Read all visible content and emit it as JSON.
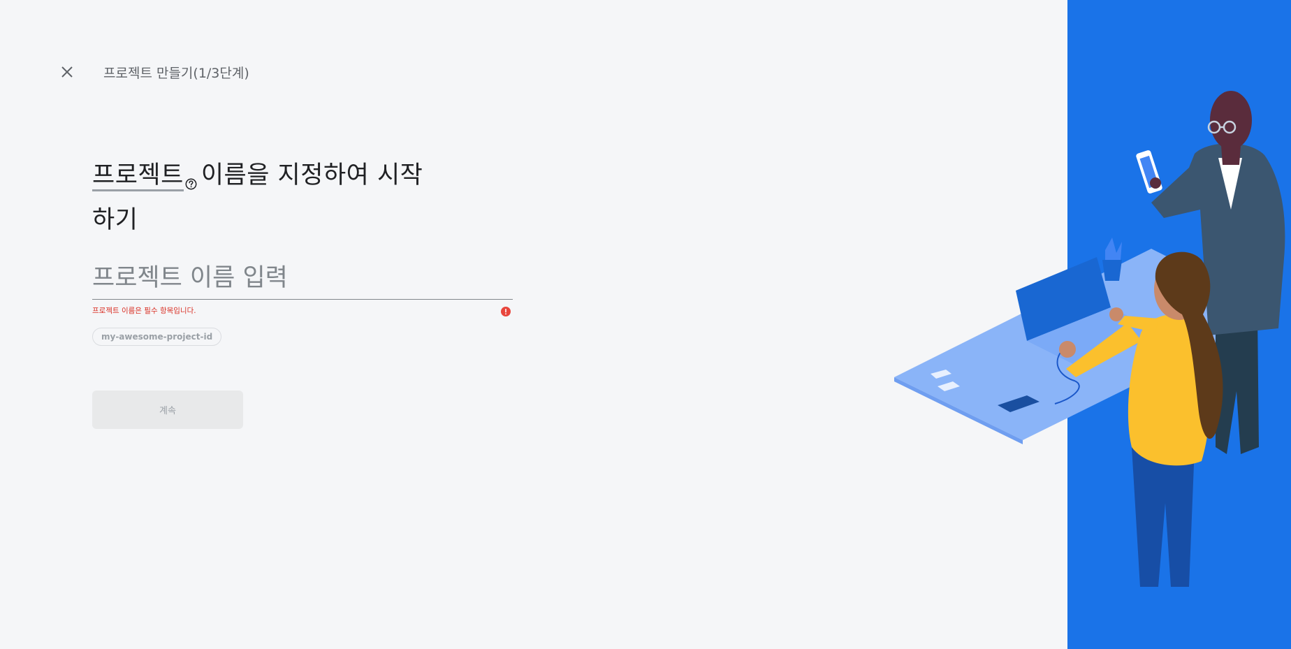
{
  "header": {
    "close_icon": "close-icon",
    "step_title": "프로젝트 만들기(1/3단계)"
  },
  "heading": {
    "term": "프로젝트",
    "help_icon": "help-circle-icon",
    "rest": "이름을 지정하여 시작",
    "line2": "하기"
  },
  "form": {
    "name_input": {
      "placeholder": "프로젝트 이름 입력",
      "value": ""
    },
    "error_message": "프로젝트 이름은 필수 항목입니다.",
    "error_icon": "error-icon",
    "project_id_chip": "my-awesome-project-id"
  },
  "actions": {
    "continue_label": "계속",
    "continue_enabled": false
  },
  "colors": {
    "background": "#f5f6f8",
    "accent_blue": "#1a73e8",
    "error": "#d93025",
    "disabled_button": "#e8e9ea"
  }
}
